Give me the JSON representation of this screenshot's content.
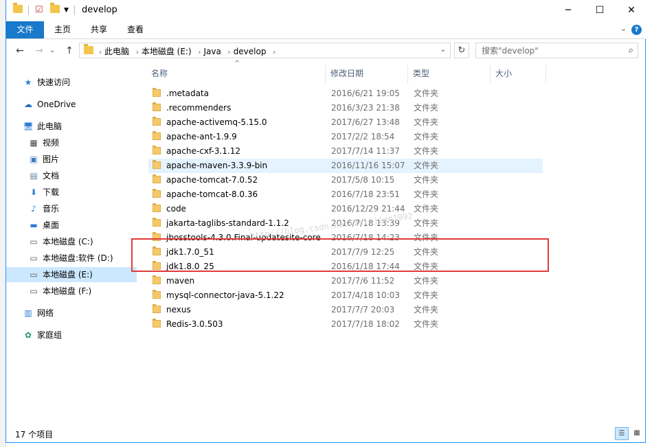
{
  "window": {
    "title": "develop",
    "controls": {
      "minimize": "─",
      "maximize": "☐",
      "close": "✕"
    }
  },
  "ribbon": {
    "tabs": [
      "文件",
      "主页",
      "共享",
      "查看"
    ],
    "active_tab": 0,
    "accent": "#1979ca"
  },
  "address": {
    "crumbs": [
      "此电脑",
      "本地磁盘 (E:)",
      "Java",
      "develop"
    ]
  },
  "search": {
    "placeholder": "搜索\"develop\""
  },
  "sidebar": {
    "items": [
      {
        "label": "快速访问",
        "icon": "star-icon",
        "glyph": "★",
        "color": "#2b7cd3"
      },
      {
        "label": "OneDrive",
        "icon": "cloud-icon",
        "glyph": "☁",
        "color": "#1f6fbf"
      },
      {
        "label": "此电脑",
        "icon": "computer-icon",
        "glyph": "🖥",
        "color": "#2b7cd3"
      },
      {
        "label": "视频",
        "icon": "video-icon",
        "glyph": "▦",
        "color": "#444444"
      },
      {
        "label": "图片",
        "icon": "picture-icon",
        "glyph": "▣",
        "color": "#3a7bbf"
      },
      {
        "label": "文档",
        "icon": "document-icon",
        "glyph": "▤",
        "color": "#607d9b"
      },
      {
        "label": "下载",
        "icon": "download-icon",
        "glyph": "⬇",
        "color": "#2b7cd3"
      },
      {
        "label": "音乐",
        "icon": "music-icon",
        "glyph": "♪",
        "color": "#2b7cd3"
      },
      {
        "label": "桌面",
        "icon": "desktop-icon",
        "glyph": "▬",
        "color": "#2b7cd3"
      },
      {
        "label": "本地磁盘 (C:)",
        "icon": "drive-icon",
        "glyph": "▭",
        "color": "#555555"
      },
      {
        "label": "本地磁盘:软件 (D:)",
        "icon": "drive-icon",
        "glyph": "▭",
        "color": "#555555"
      },
      {
        "label": "本地磁盘 (E:)",
        "icon": "drive-icon",
        "glyph": "▭",
        "color": "#555555"
      },
      {
        "label": "本地磁盘 (F:)",
        "icon": "drive-icon",
        "glyph": "▭",
        "color": "#555555"
      },
      {
        "label": "网络",
        "icon": "network-icon",
        "glyph": "▥",
        "color": "#2b7cd3"
      },
      {
        "label": "家庭组",
        "icon": "homegroup-icon",
        "glyph": "✿",
        "color": "#1f9a6a"
      }
    ],
    "selected_index": 11
  },
  "columns": [
    "名称",
    "修改日期",
    "类型",
    "大小"
  ],
  "files": [
    {
      "name": ".metadata",
      "date": "2016/6/21 19:05",
      "type": "文件夹"
    },
    {
      "name": ".recommenders",
      "date": "2016/3/23 21:38",
      "type": "文件夹"
    },
    {
      "name": "apache-activemq-5.15.0",
      "date": "2017/6/27 13:48",
      "type": "文件夹"
    },
    {
      "name": "apache-ant-1.9.9",
      "date": "2017/2/2 18:54",
      "type": "文件夹"
    },
    {
      "name": "apache-cxf-3.1.12",
      "date": "2017/7/14 11:37",
      "type": "文件夹"
    },
    {
      "name": "apache-maven-3.3.9-bin",
      "date": "2016/11/16 15:07",
      "type": "文件夹"
    },
    {
      "name": "apache-tomcat-7.0.52",
      "date": "2017/5/8 10:15",
      "type": "文件夹"
    },
    {
      "name": "apache-tomcat-8.0.36",
      "date": "2016/7/18 23:51",
      "type": "文件夹"
    },
    {
      "name": "code",
      "date": "2016/12/29 21:44",
      "type": "文件夹"
    },
    {
      "name": "jakarta-taglibs-standard-1.1.2",
      "date": "2016/7/18 13:39",
      "type": "文件夹"
    },
    {
      "name": "jbosstools-4.3.0.Final-updatesite-core",
      "date": "2016/7/18 14:23",
      "type": "文件夹"
    },
    {
      "name": "jdk1.7.0_51",
      "date": "2017/7/9 12:25",
      "type": "文件夹"
    },
    {
      "name": "jdk1.8.0_25",
      "date": "2016/1/18 17:44",
      "type": "文件夹"
    },
    {
      "name": "maven",
      "date": "2017/7/6 11:52",
      "type": "文件夹"
    },
    {
      "name": "mysql-connector-java-5.1.22",
      "date": "2017/4/18 10:03",
      "type": "文件夹"
    },
    {
      "name": "nexus",
      "date": "2017/7/7 20:03",
      "type": "文件夹"
    },
    {
      "name": "Redis-3.0.503",
      "date": "2017/7/18 18:02",
      "type": "文件夹"
    }
  ],
  "hover_row": 5,
  "highlight_color": "#e03a3a",
  "watermark": "http://blog.csdn.net/zelijian1992",
  "status": {
    "item_count": "17 个项目"
  }
}
